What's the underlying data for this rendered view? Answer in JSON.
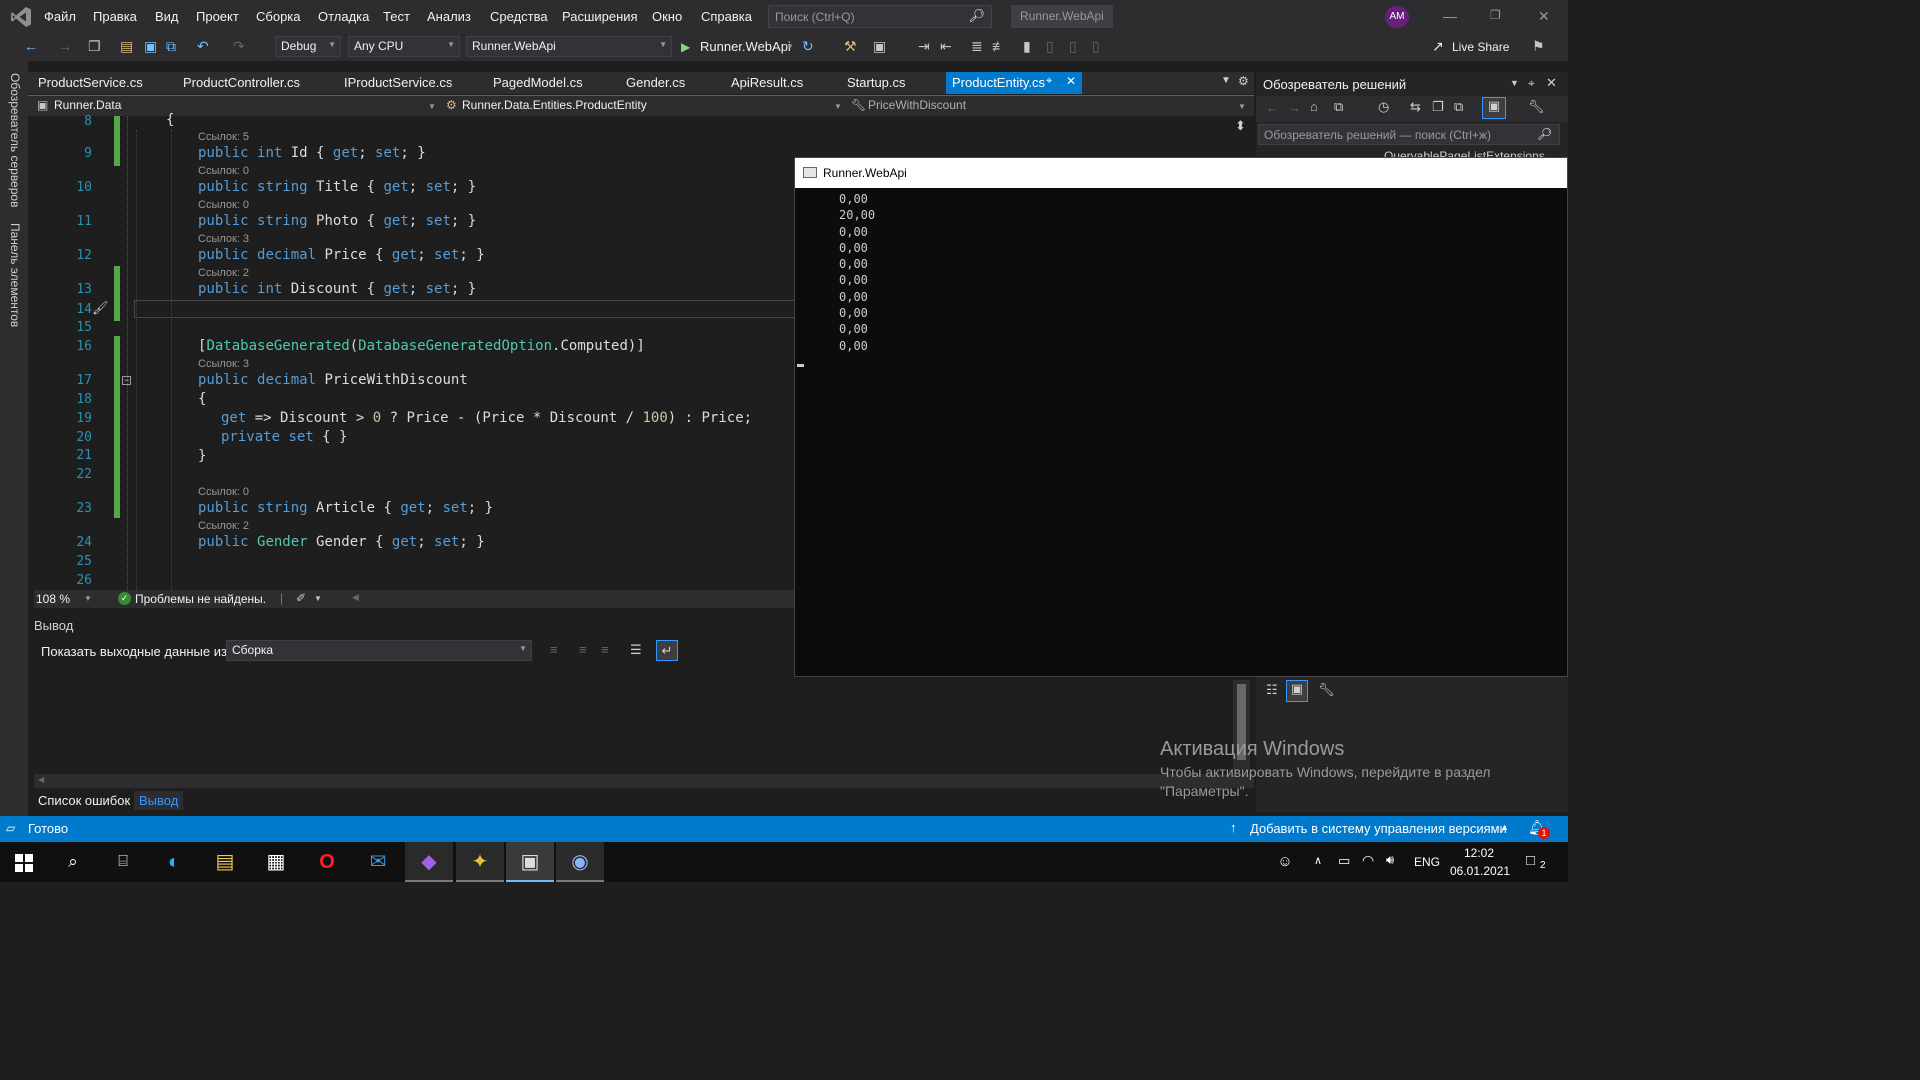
{
  "titlebar": {
    "menu": [
      "Файл",
      "Правка",
      "Вид",
      "Проект",
      "Сборка",
      "Отладка",
      "Тест",
      "Анализ",
      "Средства",
      "Расширения",
      "Окно",
      "Справка"
    ],
    "search_placeholder": "Поиск (Ctrl+Q)",
    "app_name": "Runner.WebApi",
    "avatar_initials": "AM"
  },
  "toolbar": {
    "config": "Debug",
    "platform": "Any CPU",
    "startup_project": "Runner.WebApi",
    "run_label": "Runner.WebApi",
    "live_share": "Live Share"
  },
  "left_rail": {
    "server_explorer": "Обозреватель серверов",
    "toolbox": "Панель элементов"
  },
  "tabs": [
    {
      "label": "ProductService.cs"
    },
    {
      "label": "ProductController.cs"
    },
    {
      "label": "IProductService.cs"
    },
    {
      "label": "PagedModel.cs"
    },
    {
      "label": "Gender.cs"
    },
    {
      "label": "ApiResult.cs"
    },
    {
      "label": "Startup.cs"
    },
    {
      "label": "ProductEntity.cs",
      "active": true
    }
  ],
  "navbar": {
    "project": "Runner.Data",
    "type": "Runner.Data.Entities.ProductEntity",
    "member": "PriceWithDiscount"
  },
  "editor": {
    "refs": [
      "Ссылок: 5",
      "Ссылок: 0",
      "Ссылок: 0",
      "Ссылок: 3",
      "Ссылок: 2",
      "Ссылок: 3",
      "Ссылок: 0",
      "Ссылок: 2"
    ],
    "line_numbers": [
      "8",
      "9",
      "10",
      "11",
      "12",
      "13",
      "14",
      "15",
      "16",
      "17",
      "18",
      "19",
      "20",
      "21",
      "22",
      "23",
      "24",
      "25",
      "26"
    ],
    "lines": {
      "l8": "{",
      "l9a": "public",
      "l9b": "int",
      "l9c": " Id { ",
      "l9d": "get",
      "l9e": "; ",
      "l9f": "set",
      "l9g": "; }",
      "l10a": "public",
      "l10b": "string",
      "l10c": " Title { ",
      "l10d": "get",
      "l10e": "; ",
      "l10f": "set",
      "l10g": "; }",
      "l11a": "public",
      "l11b": "string",
      "l11c": " Photo { ",
      "l11d": "get",
      "l11e": "; ",
      "l11f": "set",
      "l11g": "; }",
      "l12a": "public",
      "l12b": "decimal",
      "l12c": " Price { ",
      "l12d": "get",
      "l12e": "; ",
      "l12f": "set",
      "l12g": "; }",
      "l13a": "public",
      "l13b": "int",
      "l13c": " Discount { ",
      "l13d": "get",
      "l13e": "; ",
      "l13f": "set",
      "l13g": "; }",
      "l16a": "[",
      "l16b": "DatabaseGenerated",
      "l16c": "(",
      "l16d": "DatabaseGeneratedOption",
      "l16e": ".Computed)]",
      "l17a": "public",
      "l17b": "decimal",
      "l17c": " PriceWithDiscount",
      "l18": "{",
      "l19a": "get",
      "l19b": " => Discount > ",
      "l19c": "0",
      "l19d": " ? Price - (Price * Discount / ",
      "l19e": "100",
      "l19f": ") : Price;",
      "l20a": "private",
      "l20b": " ",
      "l20c": "set",
      "l20d": " { }",
      "l21": "}",
      "l23a": "public",
      "l23b": "string",
      "l23c": " Article { ",
      "l23d": "get",
      "l23e": "; ",
      "l23f": "set",
      "l23g": "; }",
      "l24a": "public",
      "l24b": "Gender",
      "l24c": " Gender { ",
      "l24d": "get",
      "l24e": "; ",
      "l24f": "set",
      "l24g": "; }"
    }
  },
  "editor_status": {
    "zoom": "108 %",
    "problems": "Проблемы не найдены."
  },
  "output": {
    "header": "Вывод",
    "show_from_label": "Показать выходные данные из:",
    "show_from_value": "Сборка"
  },
  "bottom_tabs": [
    "Список ошибок",
    "Вывод"
  ],
  "solution_explorer": {
    "title": "Обозреватель решений",
    "search_placeholder": "Обозреватель решений — поиск (Ctrl+ж)",
    "partial_item": "QueryablePageListExtensions"
  },
  "console": {
    "title": "Runner.WebApi",
    "output": "0,00\n20,00\n0,00\n0,00\n0,00\n0,00\n0,00\n0,00\n0,00\n0,00"
  },
  "watermark": {
    "title": "Активация Windows",
    "line1": "Чтобы активировать Windows, перейдите в раздел",
    "line2": "\"Параметры\"."
  },
  "statusbar": {
    "ready": "Готово",
    "vcs": "Добавить в систему управления версиями",
    "notifications": "1"
  },
  "taskbar": {
    "lang": "ENG",
    "time": "12:02",
    "date": "06.01.2021",
    "notif_count": "2"
  },
  "colors": {
    "accent": "#007acc",
    "keyword": "#569cd6",
    "type": "#4ec9b0",
    "number": "#b5cea8",
    "line_number": "#2b91af",
    "change_bar": "#57a64a",
    "vs_purple": "#68217a"
  }
}
